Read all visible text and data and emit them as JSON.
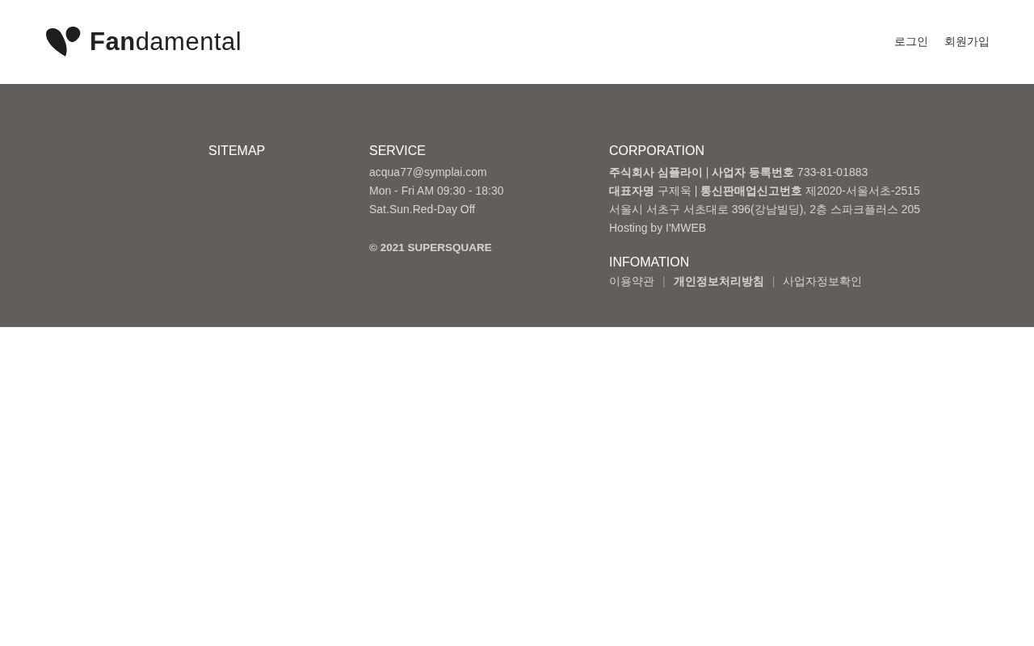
{
  "header": {
    "logo": "**Fan**damental",
    "nav": [
      {
        "label": "로그인"
      },
      {
        "label": "회원가입"
      }
    ]
  },
  "footer": {
    "sitemap": {
      "title": "SITEMAP"
    },
    "service": {
      "title": "SERVICE",
      "lines": [
        "acqua77@symplai.com",
        "Mon - Fri AM 09:30 - 18:30",
        "Sat.Sun.Red-Day Off"
      ],
      "copyright": "© 2021 SUPERSQUARE"
    },
    "corporation": {
      "title": "CORPORATION",
      "lines": [
        "**주식회사 심플라이**   |   **사업자 등록번호** 733-81-01883",
        "**대표자명** 구제욱  |  **통신판매업신고번호** 제2020-서울서초-2515",
        "서울시 서초구 서초대로 396(강남빌딩), 2층 스파크플러스 205",
        "Hosting by I'MWEB"
      ]
    },
    "infomation": {
      "title": "INFOMATION",
      "items": [
        {
          "kind": "link",
          "label": "이용약관",
          "bold": false
        },
        {
          "kind": "separator",
          "label": "|"
        },
        {
          "kind": "link",
          "label": "개인정보처리방침",
          "bold": true
        },
        {
          "kind": "separator",
          "label": "|"
        },
        {
          "kind": "link",
          "label": "사업자정보확인",
          "bold": false
        }
      ]
    }
  }
}
